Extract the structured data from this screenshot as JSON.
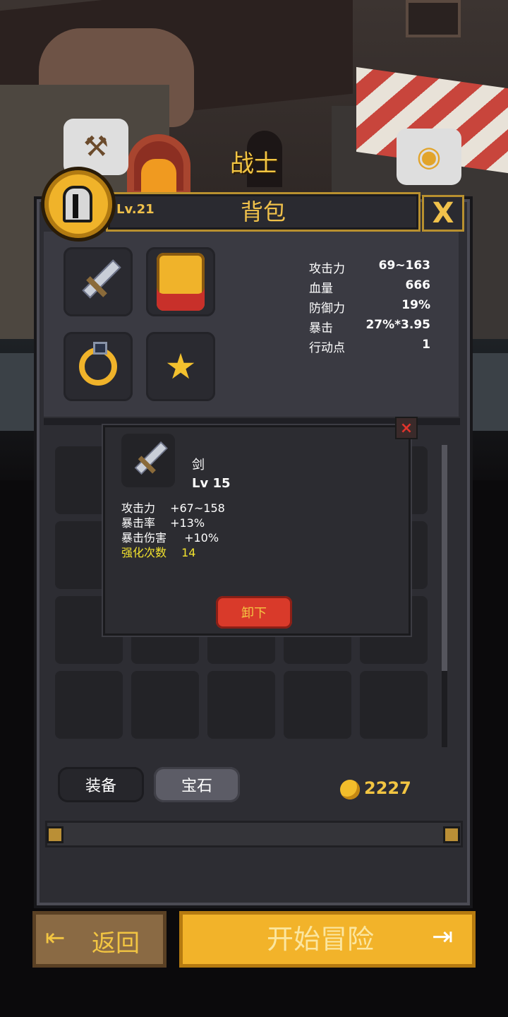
{
  "scene": {
    "class_title": "战士",
    "left_bubble_icon": "hammer-icon",
    "right_bubble_icon": "money-bag-icon"
  },
  "panel": {
    "title": "背包",
    "level": "Lv.21",
    "close_label": "X"
  },
  "equipment_slots": [
    {
      "icon": "sword-icon"
    },
    {
      "icon": "armor-icon"
    },
    {
      "icon": "ring-icon"
    },
    {
      "icon": "amulet-icon"
    }
  ],
  "stats": [
    {
      "key": "攻击力",
      "value": "69~163"
    },
    {
      "key": "血量",
      "value": "666"
    },
    {
      "key": "防御力",
      "value": "19%"
    },
    {
      "key": "暴击",
      "value": "27%*3.95"
    },
    {
      "key": "行动点",
      "value": "1"
    }
  ],
  "popup": {
    "item_name": "剑",
    "item_level": "Lv 15",
    "attributes": [
      {
        "key": "攻击力",
        "value": "+67~158"
      },
      {
        "key": "暴击率",
        "value": "+13%"
      },
      {
        "key": "暴击伤害",
        "value": "+10%"
      }
    ],
    "enhance": {
      "key": "强化次数",
      "value": "14"
    },
    "unequip_label": "卸下",
    "close_label": "×"
  },
  "tabs": {
    "equip": "装备",
    "gem": "宝石"
  },
  "gold": "2227",
  "buttons": {
    "back": "返回",
    "start": "开始冒险"
  },
  "colors": {
    "accent": "#f2c542",
    "panel": "#2d2d33",
    "unequip": "#d93a2a",
    "enhance_text": "#f2e22e"
  }
}
